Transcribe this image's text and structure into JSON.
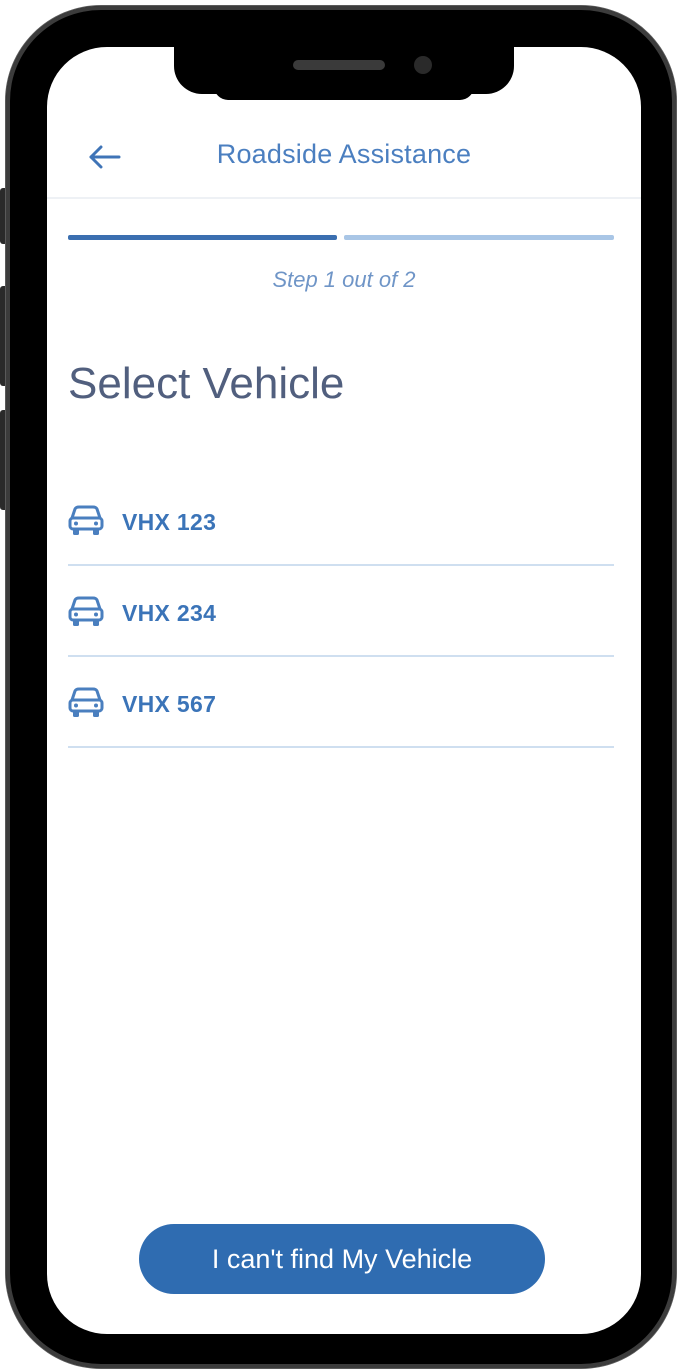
{
  "header": {
    "title": "Roadside Assistance",
    "back_icon": "arrow-left-icon"
  },
  "progress": {
    "steps_total": 2,
    "current_step": 1,
    "step_label": "Step 1 out of 2",
    "active_color": "#3b6fb0",
    "inactive_color": "#a9c6e6"
  },
  "page": {
    "heading": "Select Vehicle"
  },
  "vehicles": [
    {
      "icon": "car-icon",
      "plate": "VHX 123"
    },
    {
      "icon": "car-icon",
      "plate": "VHX 234"
    },
    {
      "icon": "car-icon",
      "plate": "VHX 567"
    }
  ],
  "footer": {
    "cant_find_label": "I can't find My Vehicle"
  },
  "colors": {
    "accent": "#2f6cb1",
    "title_text": "#4b7fc0",
    "heading_text": "#515f7e",
    "divider": "#cfdff0"
  }
}
